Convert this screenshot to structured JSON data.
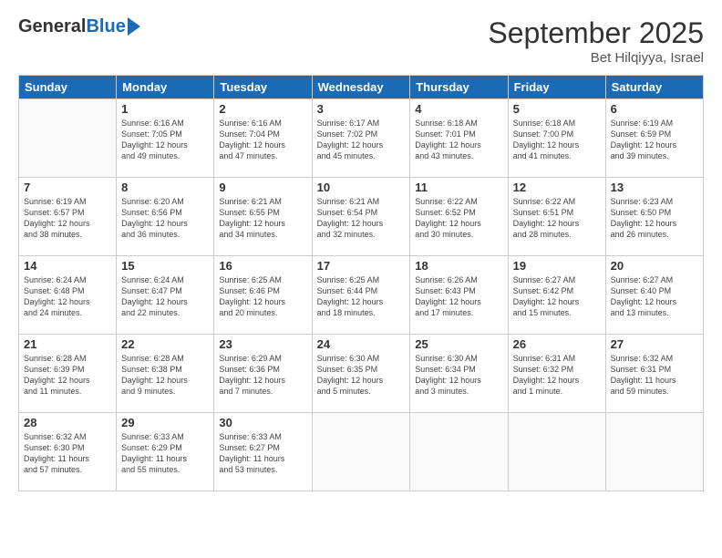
{
  "logo": {
    "general": "General",
    "blue": "Blue"
  },
  "header": {
    "month": "September 2025",
    "location": "Bet Hilqiyya, Israel"
  },
  "weekdays": [
    "Sunday",
    "Monday",
    "Tuesday",
    "Wednesday",
    "Thursday",
    "Friday",
    "Saturday"
  ],
  "weeks": [
    [
      {
        "day": "",
        "info": ""
      },
      {
        "day": "1",
        "info": "Sunrise: 6:16 AM\nSunset: 7:05 PM\nDaylight: 12 hours\nand 49 minutes."
      },
      {
        "day": "2",
        "info": "Sunrise: 6:16 AM\nSunset: 7:04 PM\nDaylight: 12 hours\nand 47 minutes."
      },
      {
        "day": "3",
        "info": "Sunrise: 6:17 AM\nSunset: 7:02 PM\nDaylight: 12 hours\nand 45 minutes."
      },
      {
        "day": "4",
        "info": "Sunrise: 6:18 AM\nSunset: 7:01 PM\nDaylight: 12 hours\nand 43 minutes."
      },
      {
        "day": "5",
        "info": "Sunrise: 6:18 AM\nSunset: 7:00 PM\nDaylight: 12 hours\nand 41 minutes."
      },
      {
        "day": "6",
        "info": "Sunrise: 6:19 AM\nSunset: 6:59 PM\nDaylight: 12 hours\nand 39 minutes."
      }
    ],
    [
      {
        "day": "7",
        "info": "Sunrise: 6:19 AM\nSunset: 6:57 PM\nDaylight: 12 hours\nand 38 minutes."
      },
      {
        "day": "8",
        "info": "Sunrise: 6:20 AM\nSunset: 6:56 PM\nDaylight: 12 hours\nand 36 minutes."
      },
      {
        "day": "9",
        "info": "Sunrise: 6:21 AM\nSunset: 6:55 PM\nDaylight: 12 hours\nand 34 minutes."
      },
      {
        "day": "10",
        "info": "Sunrise: 6:21 AM\nSunset: 6:54 PM\nDaylight: 12 hours\nand 32 minutes."
      },
      {
        "day": "11",
        "info": "Sunrise: 6:22 AM\nSunset: 6:52 PM\nDaylight: 12 hours\nand 30 minutes."
      },
      {
        "day": "12",
        "info": "Sunrise: 6:22 AM\nSunset: 6:51 PM\nDaylight: 12 hours\nand 28 minutes."
      },
      {
        "day": "13",
        "info": "Sunrise: 6:23 AM\nSunset: 6:50 PM\nDaylight: 12 hours\nand 26 minutes."
      }
    ],
    [
      {
        "day": "14",
        "info": "Sunrise: 6:24 AM\nSunset: 6:48 PM\nDaylight: 12 hours\nand 24 minutes."
      },
      {
        "day": "15",
        "info": "Sunrise: 6:24 AM\nSunset: 6:47 PM\nDaylight: 12 hours\nand 22 minutes."
      },
      {
        "day": "16",
        "info": "Sunrise: 6:25 AM\nSunset: 6:46 PM\nDaylight: 12 hours\nand 20 minutes."
      },
      {
        "day": "17",
        "info": "Sunrise: 6:25 AM\nSunset: 6:44 PM\nDaylight: 12 hours\nand 18 minutes."
      },
      {
        "day": "18",
        "info": "Sunrise: 6:26 AM\nSunset: 6:43 PM\nDaylight: 12 hours\nand 17 minutes."
      },
      {
        "day": "19",
        "info": "Sunrise: 6:27 AM\nSunset: 6:42 PM\nDaylight: 12 hours\nand 15 minutes."
      },
      {
        "day": "20",
        "info": "Sunrise: 6:27 AM\nSunset: 6:40 PM\nDaylight: 12 hours\nand 13 minutes."
      }
    ],
    [
      {
        "day": "21",
        "info": "Sunrise: 6:28 AM\nSunset: 6:39 PM\nDaylight: 12 hours\nand 11 minutes."
      },
      {
        "day": "22",
        "info": "Sunrise: 6:28 AM\nSunset: 6:38 PM\nDaylight: 12 hours\nand 9 minutes."
      },
      {
        "day": "23",
        "info": "Sunrise: 6:29 AM\nSunset: 6:36 PM\nDaylight: 12 hours\nand 7 minutes."
      },
      {
        "day": "24",
        "info": "Sunrise: 6:30 AM\nSunset: 6:35 PM\nDaylight: 12 hours\nand 5 minutes."
      },
      {
        "day": "25",
        "info": "Sunrise: 6:30 AM\nSunset: 6:34 PM\nDaylight: 12 hours\nand 3 minutes."
      },
      {
        "day": "26",
        "info": "Sunrise: 6:31 AM\nSunset: 6:32 PM\nDaylight: 12 hours\nand 1 minute."
      },
      {
        "day": "27",
        "info": "Sunrise: 6:32 AM\nSunset: 6:31 PM\nDaylight: 11 hours\nand 59 minutes."
      }
    ],
    [
      {
        "day": "28",
        "info": "Sunrise: 6:32 AM\nSunset: 6:30 PM\nDaylight: 11 hours\nand 57 minutes."
      },
      {
        "day": "29",
        "info": "Sunrise: 6:33 AM\nSunset: 6:29 PM\nDaylight: 11 hours\nand 55 minutes."
      },
      {
        "day": "30",
        "info": "Sunrise: 6:33 AM\nSunset: 6:27 PM\nDaylight: 11 hours\nand 53 minutes."
      },
      {
        "day": "",
        "info": ""
      },
      {
        "day": "",
        "info": ""
      },
      {
        "day": "",
        "info": ""
      },
      {
        "day": "",
        "info": ""
      }
    ]
  ]
}
